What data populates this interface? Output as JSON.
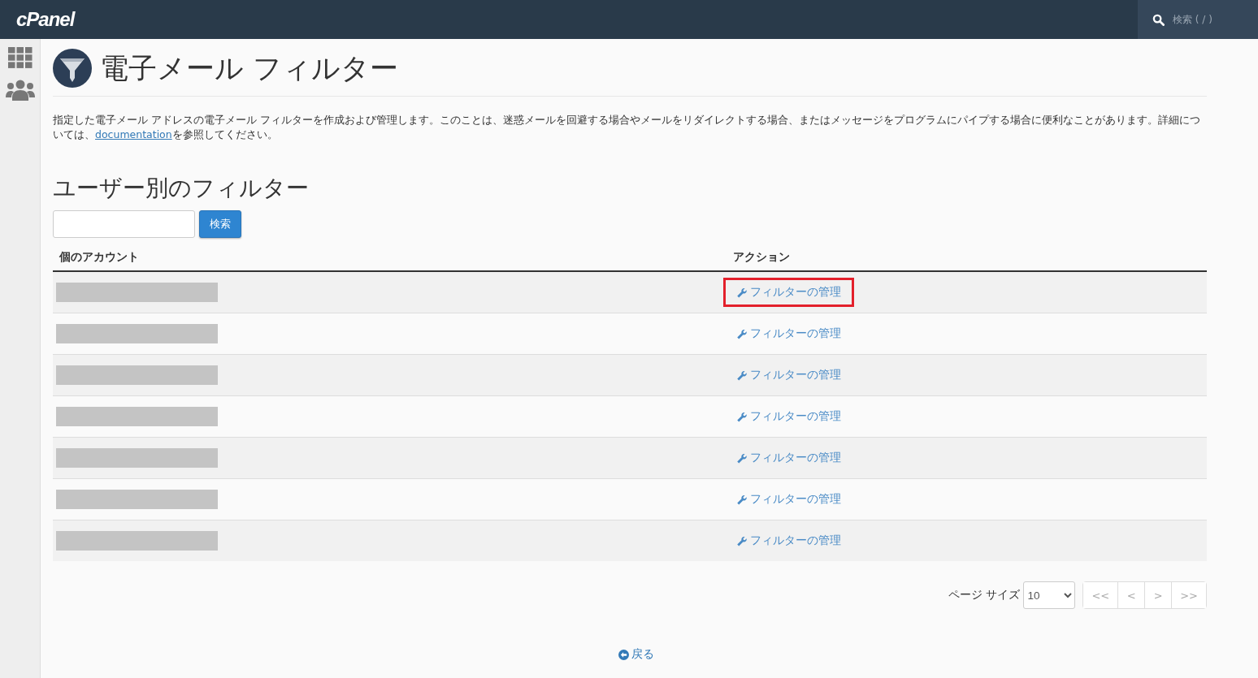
{
  "topbar": {
    "logo": "cPanel",
    "search_placeholder": "検索 ( / )"
  },
  "page": {
    "title": "電子メール フィルター",
    "description": "指定した電子メール アドレスの電子メール フィルターを作成および管理します。このことは、迷惑メールを回避する場合やメールをリダイレクトする場合、またはメッセージをプログラムにパイプする場合に便利なことがあります。詳細については、",
    "doc_link": "documentation",
    "description_end": "を参照してください。"
  },
  "section": {
    "title": "ユーザー別のフィルター",
    "search_button": "検索"
  },
  "table": {
    "columns": [
      "個のアカウント",
      "アクション"
    ],
    "rows": [
      {
        "action": "フィルターの管理",
        "highlighted": true
      },
      {
        "action": "フィルターの管理",
        "highlighted": false
      },
      {
        "action": "フィルターの管理",
        "highlighted": false
      },
      {
        "action": "フィルターの管理",
        "highlighted": false
      },
      {
        "action": "フィルターの管理",
        "highlighted": false
      },
      {
        "action": "フィルターの管理",
        "highlighted": false
      },
      {
        "action": "フィルターの管理",
        "highlighted": false
      }
    ]
  },
  "pagination": {
    "page_size_label": "ページ サイズ",
    "page_size": "10",
    "buttons": [
      {
        "label": "<<",
        "disabled": true
      },
      {
        "label": "<",
        "disabled": true
      },
      {
        "label": ">",
        "disabled": true
      },
      {
        "label": ">>",
        "disabled": true
      }
    ]
  },
  "back_link": "戻る"
}
